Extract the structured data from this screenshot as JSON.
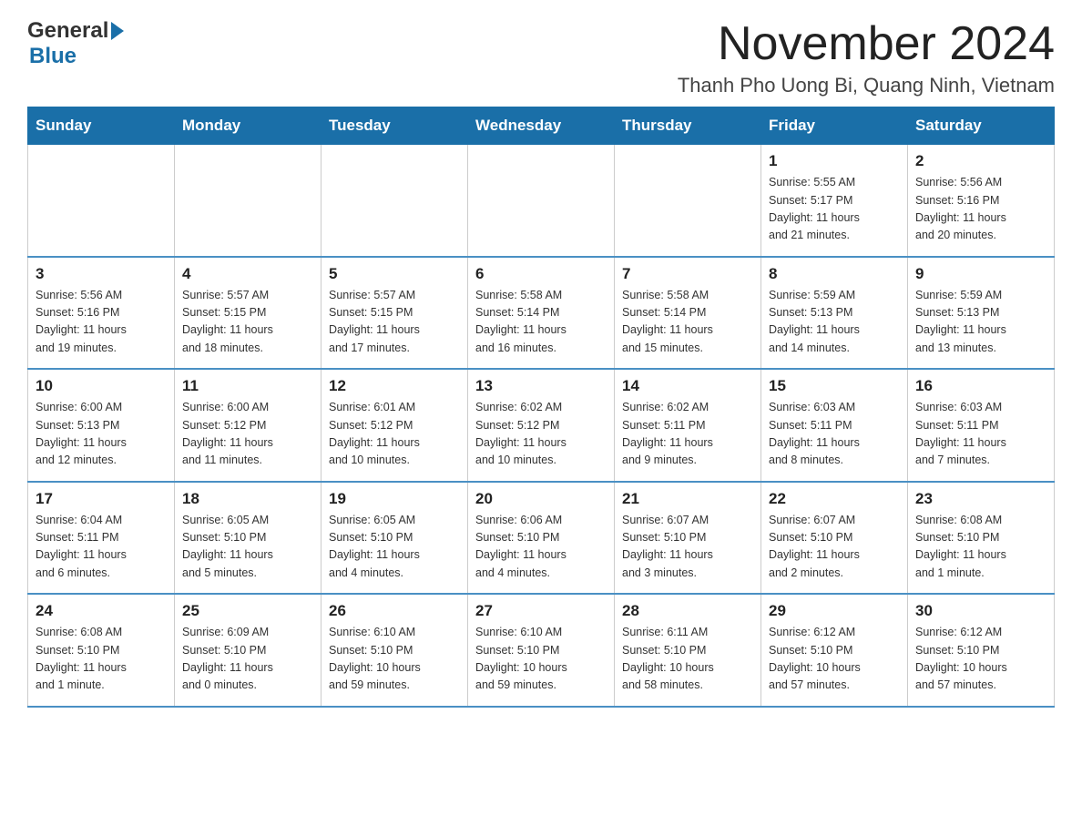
{
  "header": {
    "logo_general": "General",
    "logo_blue": "Blue",
    "title": "November 2024",
    "subtitle": "Thanh Pho Uong Bi, Quang Ninh, Vietnam"
  },
  "days_of_week": [
    "Sunday",
    "Monday",
    "Tuesday",
    "Wednesday",
    "Thursday",
    "Friday",
    "Saturday"
  ],
  "weeks": [
    {
      "days": [
        {
          "num": "",
          "info": ""
        },
        {
          "num": "",
          "info": ""
        },
        {
          "num": "",
          "info": ""
        },
        {
          "num": "",
          "info": ""
        },
        {
          "num": "",
          "info": ""
        },
        {
          "num": "1",
          "info": "Sunrise: 5:55 AM\nSunset: 5:17 PM\nDaylight: 11 hours\nand 21 minutes."
        },
        {
          "num": "2",
          "info": "Sunrise: 5:56 AM\nSunset: 5:16 PM\nDaylight: 11 hours\nand 20 minutes."
        }
      ]
    },
    {
      "days": [
        {
          "num": "3",
          "info": "Sunrise: 5:56 AM\nSunset: 5:16 PM\nDaylight: 11 hours\nand 19 minutes."
        },
        {
          "num": "4",
          "info": "Sunrise: 5:57 AM\nSunset: 5:15 PM\nDaylight: 11 hours\nand 18 minutes."
        },
        {
          "num": "5",
          "info": "Sunrise: 5:57 AM\nSunset: 5:15 PM\nDaylight: 11 hours\nand 17 minutes."
        },
        {
          "num": "6",
          "info": "Sunrise: 5:58 AM\nSunset: 5:14 PM\nDaylight: 11 hours\nand 16 minutes."
        },
        {
          "num": "7",
          "info": "Sunrise: 5:58 AM\nSunset: 5:14 PM\nDaylight: 11 hours\nand 15 minutes."
        },
        {
          "num": "8",
          "info": "Sunrise: 5:59 AM\nSunset: 5:13 PM\nDaylight: 11 hours\nand 14 minutes."
        },
        {
          "num": "9",
          "info": "Sunrise: 5:59 AM\nSunset: 5:13 PM\nDaylight: 11 hours\nand 13 minutes."
        }
      ]
    },
    {
      "days": [
        {
          "num": "10",
          "info": "Sunrise: 6:00 AM\nSunset: 5:13 PM\nDaylight: 11 hours\nand 12 minutes."
        },
        {
          "num": "11",
          "info": "Sunrise: 6:00 AM\nSunset: 5:12 PM\nDaylight: 11 hours\nand 11 minutes."
        },
        {
          "num": "12",
          "info": "Sunrise: 6:01 AM\nSunset: 5:12 PM\nDaylight: 11 hours\nand 10 minutes."
        },
        {
          "num": "13",
          "info": "Sunrise: 6:02 AM\nSunset: 5:12 PM\nDaylight: 11 hours\nand 10 minutes."
        },
        {
          "num": "14",
          "info": "Sunrise: 6:02 AM\nSunset: 5:11 PM\nDaylight: 11 hours\nand 9 minutes."
        },
        {
          "num": "15",
          "info": "Sunrise: 6:03 AM\nSunset: 5:11 PM\nDaylight: 11 hours\nand 8 minutes."
        },
        {
          "num": "16",
          "info": "Sunrise: 6:03 AM\nSunset: 5:11 PM\nDaylight: 11 hours\nand 7 minutes."
        }
      ]
    },
    {
      "days": [
        {
          "num": "17",
          "info": "Sunrise: 6:04 AM\nSunset: 5:11 PM\nDaylight: 11 hours\nand 6 minutes."
        },
        {
          "num": "18",
          "info": "Sunrise: 6:05 AM\nSunset: 5:10 PM\nDaylight: 11 hours\nand 5 minutes."
        },
        {
          "num": "19",
          "info": "Sunrise: 6:05 AM\nSunset: 5:10 PM\nDaylight: 11 hours\nand 4 minutes."
        },
        {
          "num": "20",
          "info": "Sunrise: 6:06 AM\nSunset: 5:10 PM\nDaylight: 11 hours\nand 4 minutes."
        },
        {
          "num": "21",
          "info": "Sunrise: 6:07 AM\nSunset: 5:10 PM\nDaylight: 11 hours\nand 3 minutes."
        },
        {
          "num": "22",
          "info": "Sunrise: 6:07 AM\nSunset: 5:10 PM\nDaylight: 11 hours\nand 2 minutes."
        },
        {
          "num": "23",
          "info": "Sunrise: 6:08 AM\nSunset: 5:10 PM\nDaylight: 11 hours\nand 1 minute."
        }
      ]
    },
    {
      "days": [
        {
          "num": "24",
          "info": "Sunrise: 6:08 AM\nSunset: 5:10 PM\nDaylight: 11 hours\nand 1 minute."
        },
        {
          "num": "25",
          "info": "Sunrise: 6:09 AM\nSunset: 5:10 PM\nDaylight: 11 hours\nand 0 minutes."
        },
        {
          "num": "26",
          "info": "Sunrise: 6:10 AM\nSunset: 5:10 PM\nDaylight: 10 hours\nand 59 minutes."
        },
        {
          "num": "27",
          "info": "Sunrise: 6:10 AM\nSunset: 5:10 PM\nDaylight: 10 hours\nand 59 minutes."
        },
        {
          "num": "28",
          "info": "Sunrise: 6:11 AM\nSunset: 5:10 PM\nDaylight: 10 hours\nand 58 minutes."
        },
        {
          "num": "29",
          "info": "Sunrise: 6:12 AM\nSunset: 5:10 PM\nDaylight: 10 hours\nand 57 minutes."
        },
        {
          "num": "30",
          "info": "Sunrise: 6:12 AM\nSunset: 5:10 PM\nDaylight: 10 hours\nand 57 minutes."
        }
      ]
    }
  ]
}
